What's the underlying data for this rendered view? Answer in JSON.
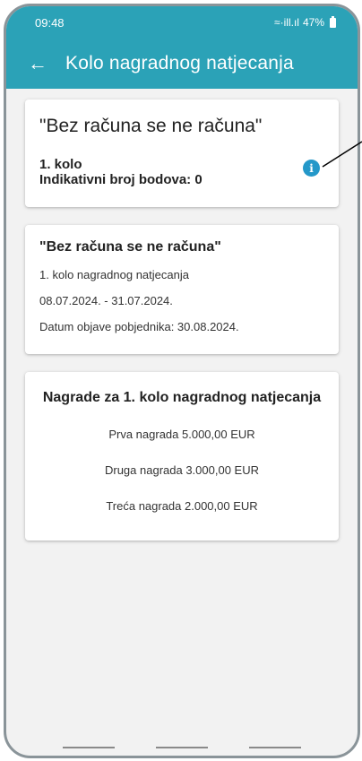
{
  "status_bar": {
    "time": "09:48",
    "signal": "≈·ill.ıl",
    "battery": "47%"
  },
  "app_bar": {
    "back_icon": "arrow-left-icon",
    "title": "Kolo nagradnog natjecanja"
  },
  "summary_card": {
    "title": "\"Bez računa se ne računa\"",
    "round": "1. kolo",
    "points": "Indikativni broj bodova: 0",
    "info_icon": "info-icon"
  },
  "details_card": {
    "title": "\"Bez računa se ne računa\"",
    "subtitle": "1. kolo nagradnog natjecanja",
    "dates": "08.07.2024. - 31.07.2024.",
    "winners_date": "Datum objave pobjednika: 30.08.2024."
  },
  "prizes_card": {
    "title": "Nagrade za 1. kolo nagradnog natjecanja",
    "prizes": [
      "Prva nagrada 5.000,00 EUR",
      "Druga nagrada 3.000,00 EUR",
      "Treća nagrada 2.000,00 EUR"
    ]
  },
  "colors": {
    "primary": "#2ba2b7",
    "info": "#2498c9"
  }
}
